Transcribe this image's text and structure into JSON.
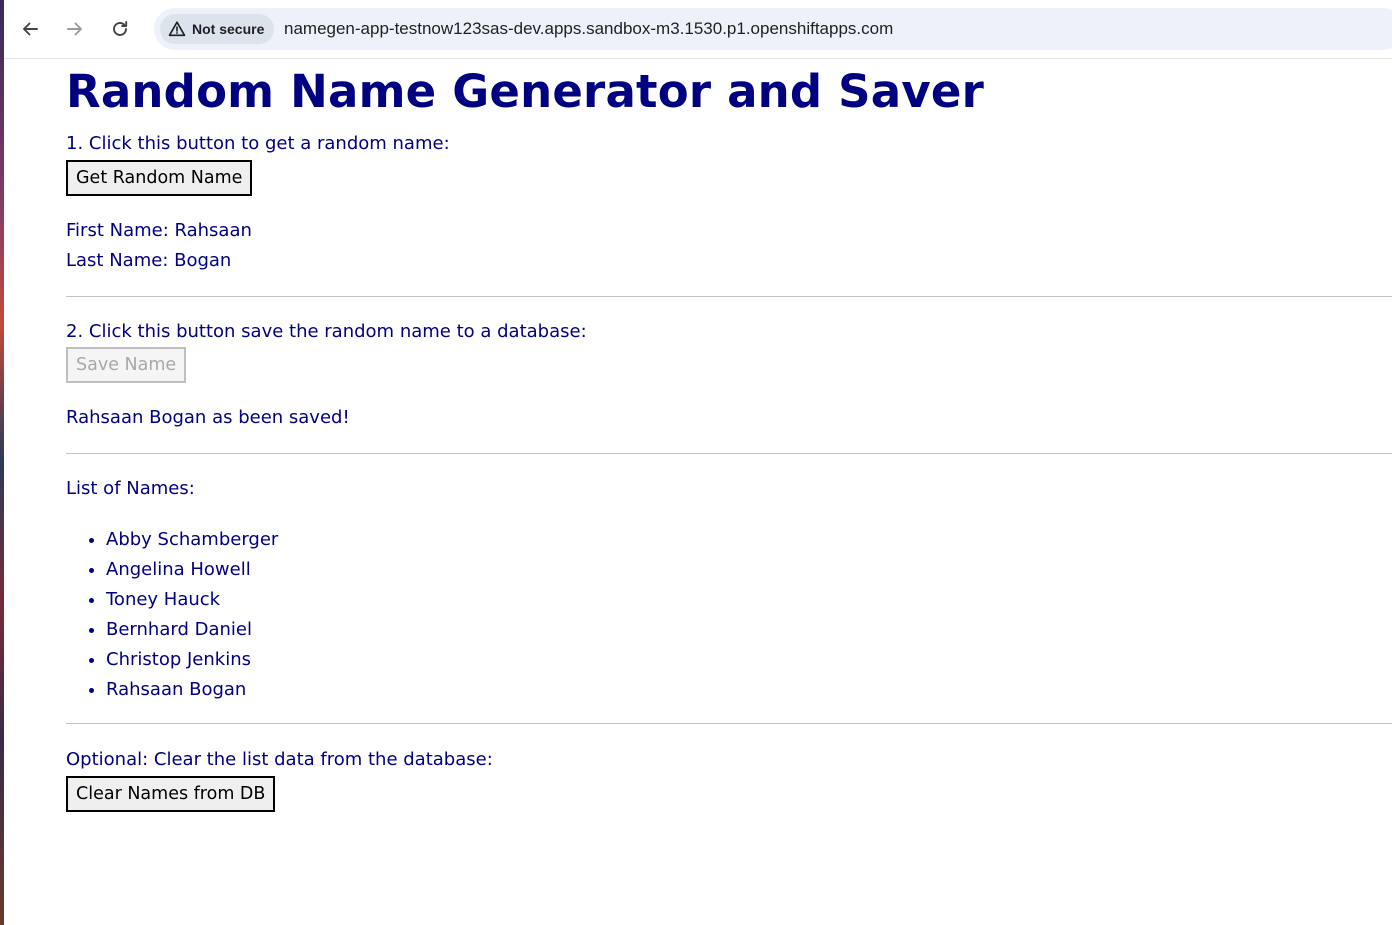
{
  "browser": {
    "security_label": "Not secure",
    "url": "namegen-app-testnow123sas-dev.apps.sandbox-m3.1530.p1.openshiftapps.com",
    "icons": {
      "back": "arrow-left-icon",
      "forward": "arrow-right-icon",
      "reload": "reload-icon",
      "security": "warning-triangle-icon"
    }
  },
  "page": {
    "title": "Random Name Generator and Saver",
    "step1": {
      "instruction": "1. Click this button to get a random name:",
      "button_label": "Get Random Name",
      "first_name_line": "First Name: Rahsaan",
      "last_name_line": "Last Name: Bogan"
    },
    "step2": {
      "instruction": "2. Click this button save the random name to a database:",
      "button_label": "Save Name",
      "button_disabled": true,
      "status": "Rahsaan Bogan as been saved!"
    },
    "list": {
      "heading": "List of Names:",
      "items": [
        "Abby Schamberger",
        "Angelina Howell",
        "Toney Hauck",
        "Bernhard Daniel",
        "Christop Jenkins",
        "Rahsaan Bogan"
      ]
    },
    "clear": {
      "instruction": "Optional: Clear the list data from the database:",
      "button_label": "Clear Names from DB"
    }
  },
  "colors": {
    "text": "#000080",
    "omnibox_bg": "#edf2fa"
  }
}
